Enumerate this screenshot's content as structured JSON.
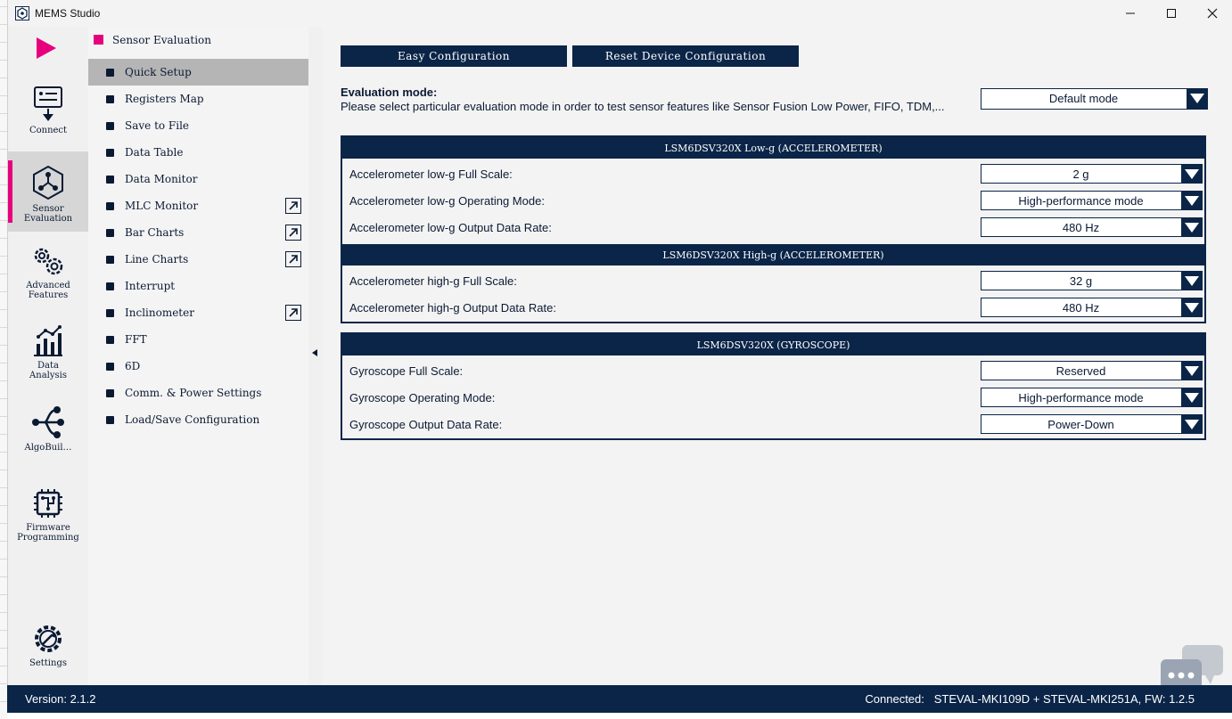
{
  "window": {
    "title": "MEMS Studio"
  },
  "sidebar": {
    "items": [
      {
        "label": "Connect",
        "icon": "connect-icon"
      },
      {
        "label": "Sensor Evaluation",
        "icon": "sensor-evaluation-icon",
        "active": true
      },
      {
        "label": "Advanced Features",
        "icon": "gears-icon"
      },
      {
        "label": "Data Analysis",
        "icon": "data-analysis-icon"
      },
      {
        "label": "AlgoBuil…",
        "icon": "algobuilder-icon"
      },
      {
        "label": "Firmware Programming",
        "icon": "chip-icon"
      },
      {
        "label": "Settings",
        "icon": "settings-icon"
      }
    ]
  },
  "submenu": {
    "title": "Sensor Evaluation",
    "items": [
      {
        "label": "Quick Setup",
        "active": true
      },
      {
        "label": "Registers Map"
      },
      {
        "label": "Save to File"
      },
      {
        "label": "Data Table"
      },
      {
        "label": "Data Monitor"
      },
      {
        "label": "MLC Monitor",
        "external": true
      },
      {
        "label": "Bar Charts",
        "external": true
      },
      {
        "label": "Line Charts",
        "external": true
      },
      {
        "label": "Interrupt"
      },
      {
        "label": "Inclinometer",
        "external": true
      },
      {
        "label": "FFT"
      },
      {
        "label": "6D"
      },
      {
        "label": "Comm. & Power Settings"
      },
      {
        "label": "Load/Save Configuration"
      }
    ]
  },
  "main": {
    "buttons": {
      "easy": "Easy Configuration",
      "reset": "Reset Device Configuration"
    },
    "eval": {
      "title": "Evaluation mode:",
      "desc": "Please select particular evaluation mode in order to test sensor features like Sensor Fusion Low Power, FIFO, TDM,...",
      "value": "Default mode"
    },
    "panels": [
      {
        "sections": [
          {
            "header": "LSM6DSV320X Low-g (ACCELEROMETER)",
            "rows": [
              {
                "label": "Accelerometer low-g Full Scale:",
                "value": "2 g"
              },
              {
                "label": "Accelerometer low-g Operating Mode:",
                "value": "High-performance mode"
              },
              {
                "label": "Accelerometer low-g Output Data Rate:",
                "value": "480 Hz"
              }
            ]
          },
          {
            "header": "LSM6DSV320X High-g (ACCELEROMETER)",
            "rows": [
              {
                "label": "Accelerometer high-g Full Scale:",
                "value": "32 g"
              },
              {
                "label": "Accelerometer high-g Output Data Rate:",
                "value": "480 Hz"
              }
            ]
          }
        ]
      },
      {
        "sections": [
          {
            "header": "LSM6DSV320X (GYROSCOPE)",
            "rows": [
              {
                "label": "Gyroscope Full Scale:",
                "value": "Reserved"
              },
              {
                "label": "Gyroscope Operating Mode:",
                "value": "High-performance mode"
              },
              {
                "label": "Gyroscope Output Data Rate:",
                "value": "Power-Down"
              }
            ]
          }
        ]
      }
    ]
  },
  "status": {
    "version": "Version: 2.1.2",
    "connected_label": "Connected:",
    "connected_value": "STEVAL-MKI109D + STEVAL-MKI251A, FW: 1.2.5"
  },
  "colors": {
    "accent": "#e6007e",
    "navy": "#0b2548"
  }
}
